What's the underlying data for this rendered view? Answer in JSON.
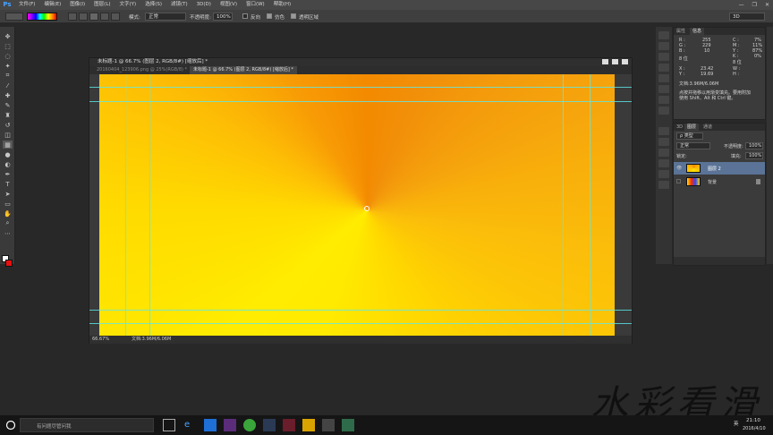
{
  "menubar": {
    "logo": "Ps",
    "items": [
      "文件(F)",
      "编辑(E)",
      "图像(I)",
      "图层(L)",
      "文字(Y)",
      "选择(S)",
      "滤镜(T)",
      "3D(D)",
      "视图(V)",
      "窗口(W)",
      "帮助(H)"
    ],
    "win_controls": [
      "—",
      "❐",
      "✕"
    ]
  },
  "options": {
    "mode_label": "模式:",
    "mode_value": "正常",
    "opacity_label": "不透明度:",
    "opacity_value": "100%",
    "reverse_label": "反向",
    "dither_label": "仿色",
    "transparency_label": "透明区域",
    "workspace_value": "3D"
  },
  "document": {
    "title": "未标题-1 @ 66.7% (图层 2, RGB/8#) [缩放后] *",
    "tab1": "20160404_123906.png @ 25%(RGB/8) *",
    "tab2": "未标题-1 @ 66.7% (图层 2, RGB/8#) [缩放后] *",
    "zoom": "66.67%",
    "doc_size": "文档:3.96M/6.06M"
  },
  "info": {
    "tab1": "属性",
    "tab2": "信息",
    "r_label": "R :",
    "r_val": "255",
    "g_label": "G :",
    "g_val": "229",
    "b_label": "B :",
    "b_val": "10",
    "bit_l": "8 位",
    "c_label": "C :",
    "c_val": "7%",
    "m_label": "M :",
    "m_val": "11%",
    "y_label": "Y :",
    "y_val": "87%",
    "k_label": "K :",
    "k_val": "0%",
    "bit_r": "8 位",
    "x_label": "X :",
    "x_val": "23.42",
    "y2_label": "Y :",
    "y2_val": "19.69",
    "w_label": "W :",
    "h_label": "H :",
    "doc_line": "文档:3.96M/6.06M",
    "hint1": "点按并拖移以用渐变填充。要用附加",
    "hint2": "使用 Shift、Alt 和 Ctrl 键。"
  },
  "layers": {
    "tabs": [
      "3D",
      "图层",
      "通道"
    ],
    "kind": "ρ 类型",
    "blend": "正常",
    "opacity_label": "不透明度:",
    "opacity": "100%",
    "lock_label": "锁定:",
    "fill_label": "填充:",
    "fill": "100%",
    "items": [
      {
        "name": "图层 2"
      },
      {
        "name": "背景"
      }
    ]
  },
  "taskbar": {
    "search": "有问题尽管问我",
    "time": "21:10",
    "date": "2016/4/10",
    "lang": "英"
  },
  "watermark": "水彩看滑"
}
